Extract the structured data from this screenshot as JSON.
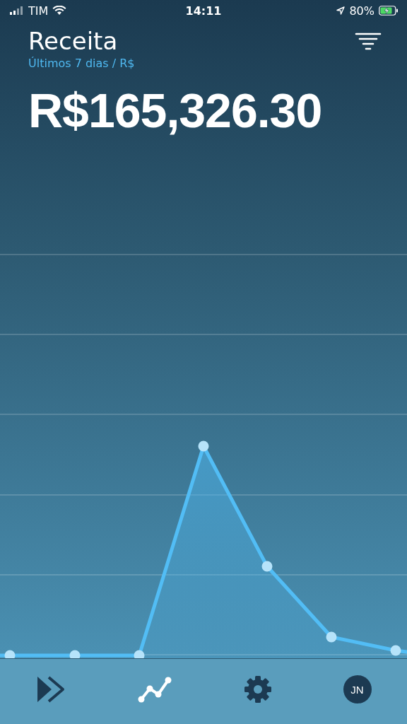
{
  "status_bar": {
    "carrier": "TIM",
    "time": "14:11",
    "battery": "80%",
    "charging": true
  },
  "header": {
    "title": "Receita",
    "subtitle": "Últimos 7 dias / R$",
    "total": "R$165,326.30"
  },
  "tabs": [
    {
      "kind": "forward",
      "selected": false
    },
    {
      "kind": "chart",
      "selected": true
    },
    {
      "kind": "settings",
      "selected": false
    },
    {
      "kind": "avatar",
      "initials": "JN",
      "selected": false
    }
  ]
}
